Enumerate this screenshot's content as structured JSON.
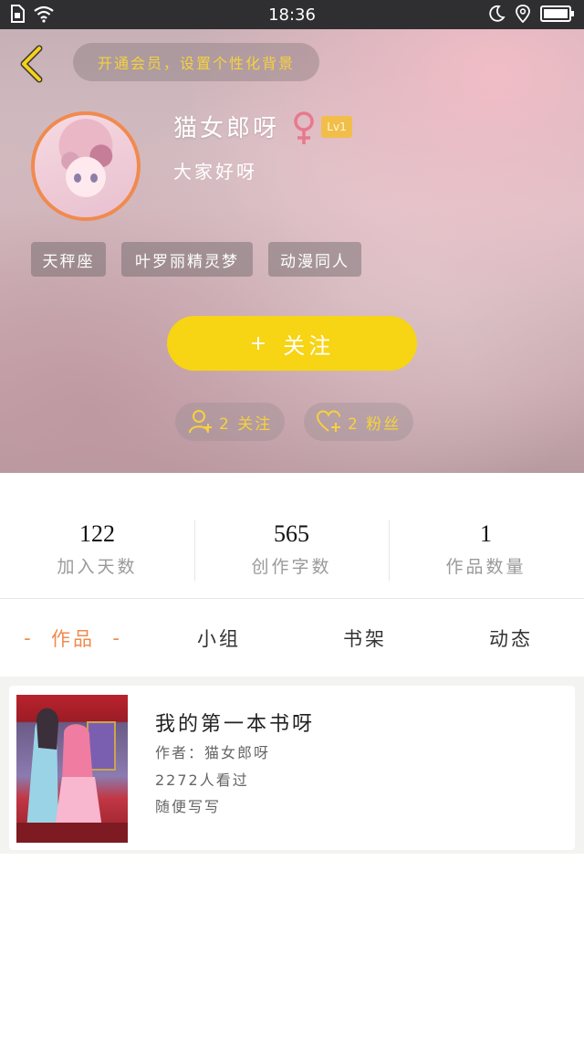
{
  "status_bar": {
    "time": "18:36"
  },
  "header": {
    "vip_banner": "开通会员，设置个性化背景"
  },
  "profile": {
    "username": "猫女郎呀",
    "level": "Lv1",
    "bio": "大家好呀",
    "tags": [
      "天秤座",
      "叶罗丽精灵梦",
      "动漫同人"
    ],
    "follow_label": "关注",
    "following_count_label": "2 关注",
    "fans_count_label": "2 粉丝"
  },
  "stats": [
    {
      "value": "122",
      "label": "加入天数"
    },
    {
      "value": "565",
      "label": "创作字数"
    },
    {
      "value": "1",
      "label": "作品数量"
    }
  ],
  "tabs": [
    {
      "label": "作品",
      "active": true
    },
    {
      "label": "小组",
      "active": false
    },
    {
      "label": "书架",
      "active": false
    },
    {
      "label": "动态",
      "active": false
    }
  ],
  "works": [
    {
      "title": "我的第一本书呀",
      "author": "作者：猫女郎呀",
      "views": "2272人看过",
      "summary": "随便写写"
    }
  ],
  "colors": {
    "accent_yellow": "#f7d414",
    "accent_orange": "#f08a4e",
    "status_bar": "#2f2f31"
  }
}
